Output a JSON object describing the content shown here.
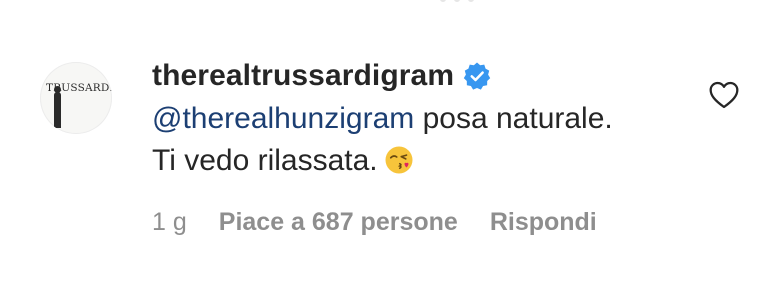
{
  "comment": {
    "avatar_logo_text": "TRUSSARDI",
    "username": "therealtrussardigram",
    "mention": "@therealhunzigram",
    "text_line1": " posa naturale.",
    "text_line2": "Ti vedo rilassata.",
    "emoji": "face-blowing-a-kiss",
    "time": "1 g",
    "likes": "Piace a 687 persone",
    "reply_label": "Rispondi"
  },
  "icons": {
    "verified": "verified-badge-icon",
    "like": "heart-outline-icon"
  },
  "colors": {
    "text": "#262626",
    "mention": "#1c3f73",
    "meta": "#8e8e8e",
    "verified": "#3897f0"
  }
}
